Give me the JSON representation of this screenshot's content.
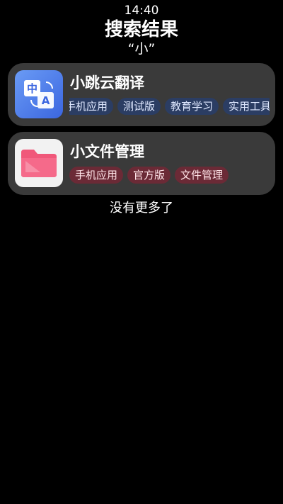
{
  "status": {
    "time": "14:40"
  },
  "header": {
    "title": "搜索结果",
    "query": "“小”"
  },
  "results": [
    {
      "name": "小跳云翻译",
      "icon": "translate-icon",
      "tags": [
        "手机应用",
        "测试版",
        "教育学习",
        "实用工具"
      ],
      "tag_color": "#2b3d63"
    },
    {
      "name": "小文件管理",
      "icon": "folder-icon",
      "tags": [
        "手机应用",
        "官方版",
        "文件管理"
      ],
      "tag_color": "#6b2a36"
    }
  ],
  "footer": {
    "no_more": "没有更多了"
  },
  "colors": {
    "card_background": "#3a3a3a",
    "translate_icon": "#3b66e0",
    "folder_icon": "#f0587a"
  }
}
